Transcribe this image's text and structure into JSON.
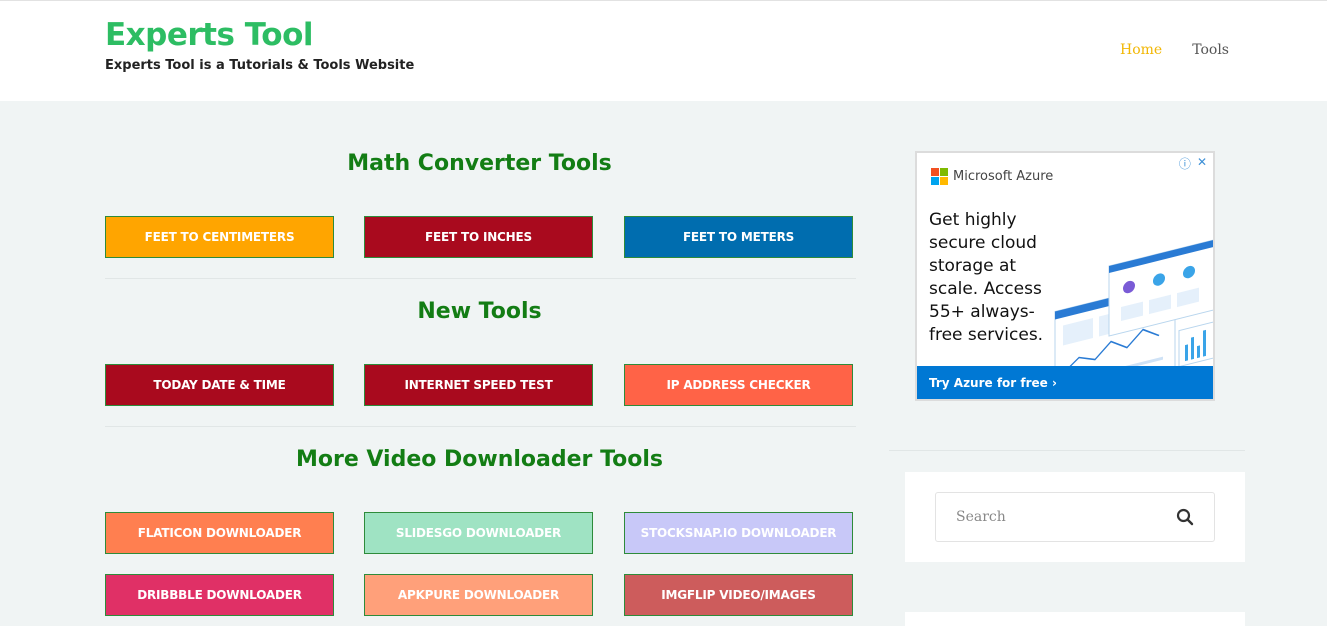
{
  "header": {
    "site_title": "Experts Tool",
    "tagline": "Experts Tool is a Tutorials & Tools Website",
    "nav": [
      {
        "label": "Home",
        "active": true
      },
      {
        "label": "Tools",
        "active": false
      }
    ]
  },
  "sections": [
    {
      "title": "Math Converter Tools",
      "buttons": [
        {
          "label": "FEET TO CENTIMETERS",
          "color": "#ffa500"
        },
        {
          "label": "FEET TO INCHES",
          "color": "#a90a1e"
        },
        {
          "label": "FEET TO METERS",
          "color": "#006daf"
        }
      ]
    },
    {
      "title": "New Tools",
      "buttons": [
        {
          "label": "TODAY DATE & TIME",
          "color": "#a90a1e"
        },
        {
          "label": "INTERNET SPEED TEST",
          "color": "#a90a1e"
        },
        {
          "label": "IP ADDRESS CHECKER",
          "color": "#ff6347"
        }
      ]
    },
    {
      "title": "More Video Downloader Tools",
      "buttons": [
        {
          "label": "FLATICON DOWNLOADER",
          "color": "#ff7f50"
        },
        {
          "label": "SLIDESGO DOWNLOADER",
          "color": "#9fe3c3"
        },
        {
          "label": "STOCKSNAP.IO DOWNLOADER",
          "color": "#c8c8f8"
        },
        {
          "label": "DRIBBBLE DOWNLOADER",
          "color": "#e03066"
        },
        {
          "label": "APKPURE DOWNLOADER",
          "color": "#ffa07a"
        },
        {
          "label": "IMGFLIP VIDEO/IMAGES",
          "color": "#cd5c5c"
        }
      ]
    }
  ],
  "ad": {
    "brand": "Microsoft Azure",
    "headline": "Get highly secure cloud storage at scale. Access 55+ always-free services.",
    "cta": "Try Azure for free ›",
    "icons": [
      "info-icon",
      "close-icon"
    ]
  },
  "search": {
    "placeholder": "Search",
    "icon": "search-icon"
  },
  "colors": {
    "brand_green": "#2dbd63",
    "title_green": "#137d14",
    "nav_active": "#f2b705"
  }
}
